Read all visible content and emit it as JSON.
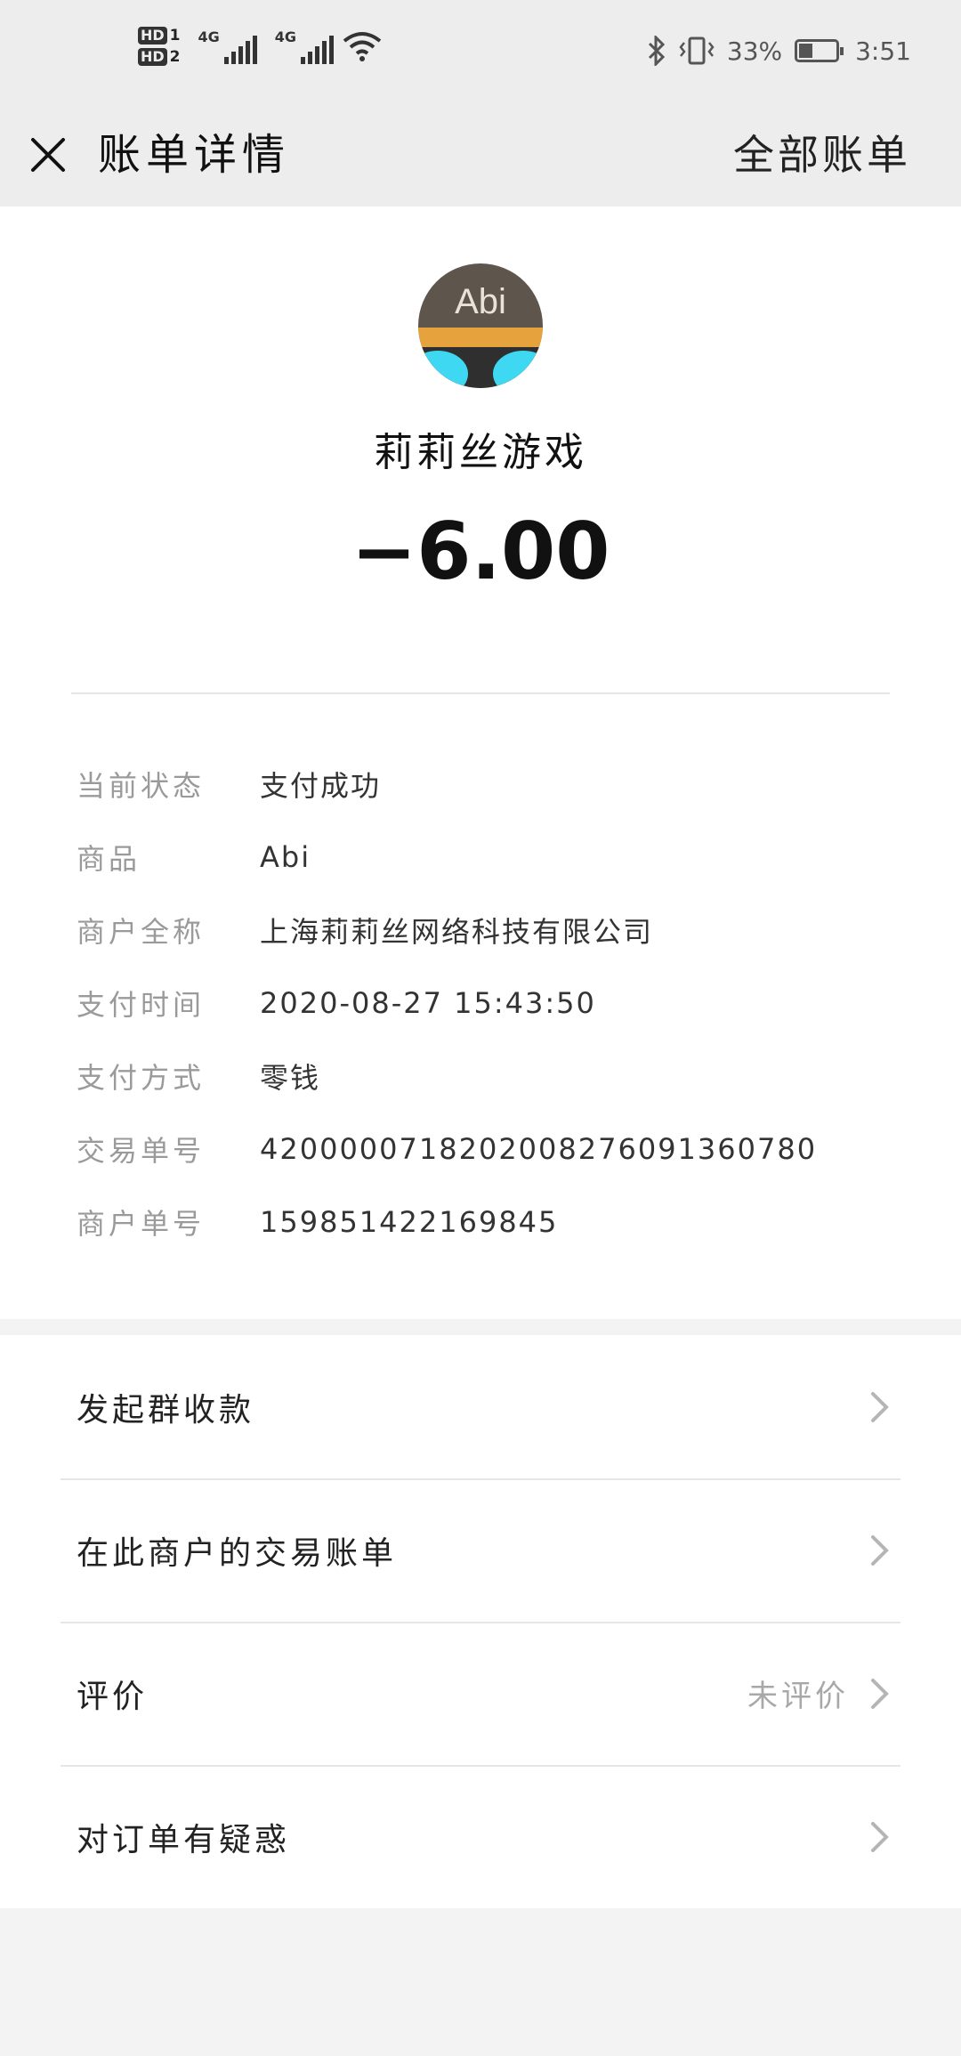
{
  "status_bar": {
    "sim1": "HD",
    "sim1_index": "1",
    "sim2": "HD",
    "sim2_index": "2",
    "net1": "4G",
    "net2": "4G",
    "battery_percent": "33%",
    "battery_level": 0.33,
    "time": "3:51"
  },
  "header": {
    "title": "账单详情",
    "action": "全部账单"
  },
  "merchant": {
    "avatar_text": "Abi",
    "name": "莉莉丝游戏"
  },
  "amount": "−6.00",
  "details": [
    {
      "label": "当前状态",
      "value": "支付成功"
    },
    {
      "label": "商品",
      "value": "Abi"
    },
    {
      "label": "商户全称",
      "value": "上海莉莉丝网络科技有限公司"
    },
    {
      "label": "支付时间",
      "value": "2020-08-27 15:43:50"
    },
    {
      "label": "支付方式",
      "value": "零钱"
    },
    {
      "label": "交易单号",
      "value": "4200000718202008276091360780"
    },
    {
      "label": "商户单号",
      "value": "159851422169845"
    }
  ],
  "actions": [
    {
      "label": "发起群收款",
      "value": ""
    },
    {
      "label": "在此商户的交易账单",
      "value": ""
    },
    {
      "label": "评价",
      "value": "未评价"
    },
    {
      "label": "对订单有疑惑",
      "value": ""
    }
  ],
  "colors": {
    "header_bg": "#ededed",
    "card_bg": "#ffffff",
    "page_bg": "#f3f3f3",
    "label_gray": "#9a9a9a",
    "text_dark": "#111111",
    "avatar_cyan": "#3fd8f2",
    "avatar_orange": "#e6a23c"
  },
  "icons": {
    "close": "close-icon",
    "chevron": "chevron-right-icon",
    "bluetooth": "bluetooth-icon",
    "vibrate": "vibrate-icon",
    "wifi": "wifi-icon",
    "battery": "battery-icon"
  }
}
